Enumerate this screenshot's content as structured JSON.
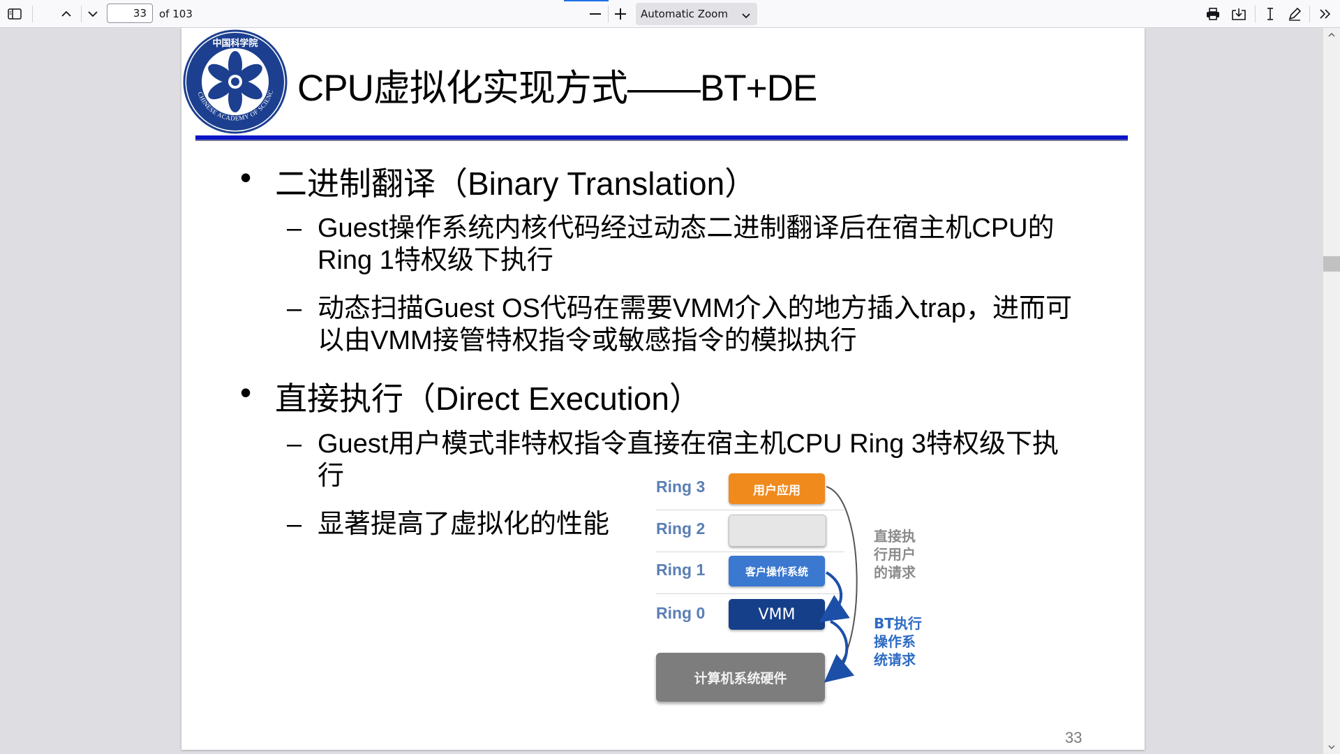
{
  "toolbar": {
    "page_number": "33",
    "page_count": "of 103",
    "zoom_label": "Automatic Zoom",
    "icons": [
      "sidebar-toggle-icon",
      "previous-page-icon",
      "next-page-icon",
      "zoom-out-icon",
      "zoom-in-icon",
      "print-icon",
      "save-icon",
      "text-cursor-icon",
      "draw-icon",
      "more-tools-icon"
    ]
  },
  "slide": {
    "title": "CPU虚拟化实现方式——BT+DE",
    "logo_text": "CHINESE ACADEMY OF SCIENCES",
    "logo_cn": "中国科学院",
    "bullets": [
      {
        "text": "二进制翻译（Binary Translation）",
        "subs": [
          {
            "line1": "Guest操作系统内核代码经过动态二进制翻译后在宿主机CPU的",
            "line2": "Ring 1特权级下执行"
          },
          {
            "line1": "动态扫描Guest OS代码在需要VMM介入的地方插入trap，进而可",
            "line2": "以由VMM接管特权指令或敏感指令的模拟执行"
          }
        ]
      },
      {
        "text": "直接执行（Direct Execution）",
        "subs": [
          {
            "line1": "Guest用户模式非特权指令直接在宿主机CPU Ring 3特权级下执",
            "line2": "行"
          },
          {
            "line1": "显著提高了虚拟化的性能",
            "line2": ""
          }
        ]
      }
    ],
    "page_number": "33"
  },
  "diagram": {
    "rings": [
      {
        "label": "Ring 3",
        "box": "用户应用",
        "color": "#f08a1c"
      },
      {
        "label": "Ring 2",
        "box": "",
        "color": "#e6e6e6"
      },
      {
        "label": "Ring 1",
        "box": "客户操作系统",
        "color": "#3b78d0"
      },
      {
        "label": "Ring 0",
        "box": "VMM",
        "color": "#163f8a"
      }
    ],
    "hardware": "计算机系统硬件",
    "note_direct": "直接执\n行用户\n的请求",
    "note_bt": "BT执行\n操作系\n统请求"
  }
}
